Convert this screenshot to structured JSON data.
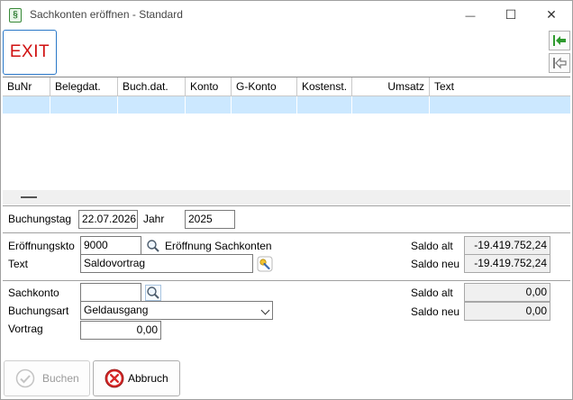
{
  "window": {
    "title": "Sachkonten eröffnen - Standard",
    "app_icon_glyph": "§",
    "minimize_glyph": "—",
    "maximize_glyph": "☐",
    "close_glyph": "✕"
  },
  "toolbar": {
    "exit_label": "EXIT",
    "nav_first_icon": "green-arrow-left-to-bar-icon",
    "nav_prev_icon": "grey-arrow-left-to-bar-icon"
  },
  "grid": {
    "columns": [
      "BuNr",
      "Belegdat.",
      "Buch.dat.",
      "Konto",
      "G-Konto",
      "Kostenst.",
      "Umsatz",
      "Text"
    ],
    "selected_row": [
      "",
      "",
      "",
      "",
      "",
      "",
      "",
      ""
    ]
  },
  "booking_day": {
    "label": "Buchungstag",
    "value": "22.07.2026",
    "year_label": "Jahr",
    "year_value": "2025"
  },
  "opening": {
    "account_label": "Eröffnungskto",
    "account_value": "9000",
    "account_name": "Eröffnung Sachkonten",
    "text_label": "Text",
    "text_value": "Saldovortrag",
    "balance_old_label": "Saldo alt",
    "balance_old_value": "-19.419.752,24",
    "balance_new_label": "Saldo neu",
    "balance_new_value": "-19.419.752,24"
  },
  "posting": {
    "account_label": "Sachkonto",
    "account_value": "",
    "type_label": "Buchungsart",
    "type_value": "Geldausgang",
    "carry_label": "Vortrag",
    "carry_value": "0,00",
    "balance_old_label": "Saldo alt",
    "balance_old_value": "0,00",
    "balance_new_label": "Saldo neu",
    "balance_new_value": "0,00"
  },
  "buttons": {
    "book_label": "Buchen",
    "cancel_label": "Abbruch"
  },
  "colors": {
    "exit_text": "#d01010",
    "selection": "#cce8ff",
    "cancel_icon": "#d62828",
    "nav_arrow": "#2e9a2e"
  }
}
